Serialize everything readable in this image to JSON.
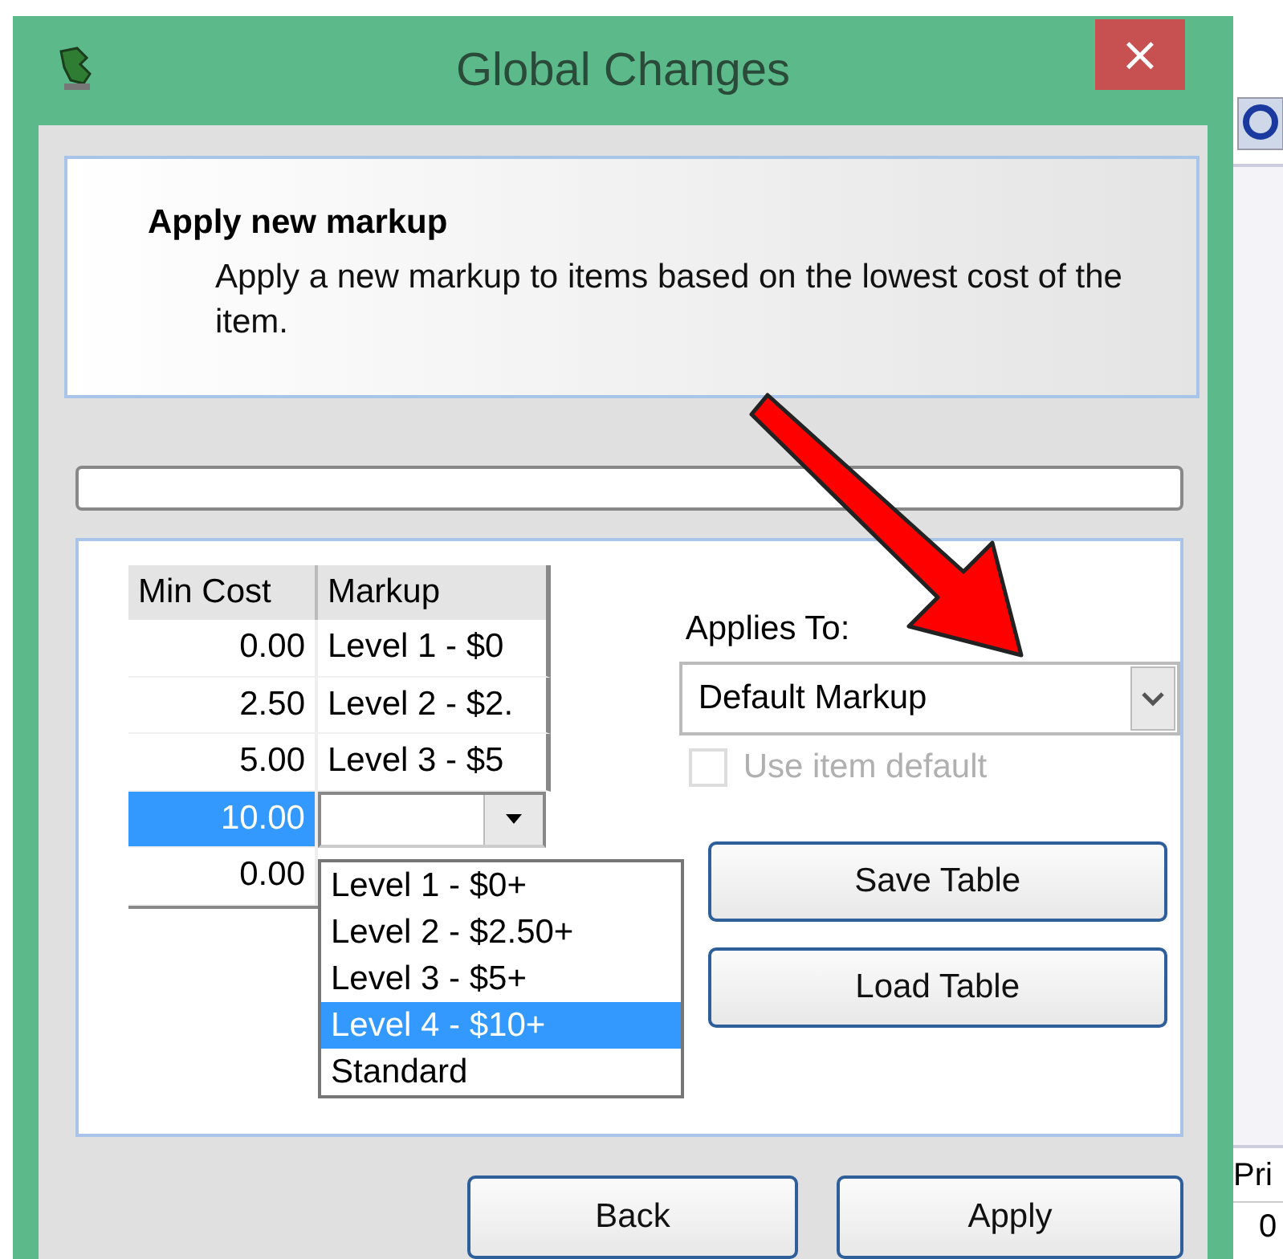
{
  "window": {
    "title": "Global Changes",
    "close_label": "×"
  },
  "header": {
    "title": "Apply new markup",
    "description": "Apply a new markup to items based on the lowest cost of the item."
  },
  "progress": {
    "level": 0
  },
  "grid": {
    "columns": [
      "Min Cost",
      "Markup"
    ],
    "rows": [
      {
        "min_cost": "0.00",
        "markup": "Level 1 - $0",
        "kind": "text",
        "selected": false
      },
      {
        "min_cost": "2.50",
        "markup": "Level 2 - $2.",
        "kind": "text",
        "selected": false
      },
      {
        "min_cost": "5.00",
        "markup": "Level 3 - $5",
        "kind": "text",
        "selected": false
      },
      {
        "min_cost": "10.00",
        "kind": "editor",
        "selected": true
      },
      {
        "min_cost": "0.00",
        "kind": "new",
        "selected": false
      }
    ]
  },
  "dropdown_list": [
    {
      "label": "Level 1 - $0+",
      "selected": false
    },
    {
      "label": "Level 2 - $2.50+",
      "selected": false
    },
    {
      "label": "Level 3 - $5+",
      "selected": false
    },
    {
      "label": "Level 4 - $10+",
      "selected": true
    },
    {
      "label": "Standard",
      "selected": false
    }
  ],
  "applies_to": {
    "label": "Applies To:",
    "value": "Default Markup"
  },
  "use_item_default": {
    "label": "Use item default",
    "checked": false,
    "disabled": true
  },
  "side_buttons": [
    "Save Table",
    "Load Table"
  ],
  "footer_buttons": [
    "Back",
    "Apply"
  ],
  "background_app": {
    "column_header": "Pri",
    "cell": "0"
  }
}
